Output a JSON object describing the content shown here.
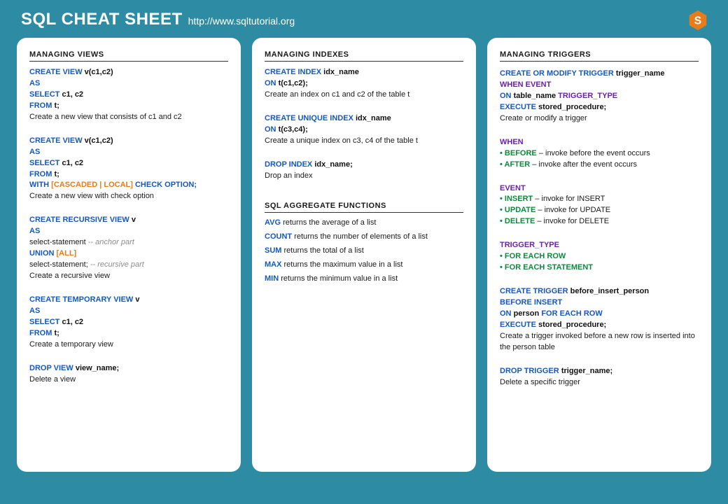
{
  "header": {
    "title": "SQL CHEAT SHEET",
    "url": "http://www.sqltutorial.org"
  },
  "col1": {
    "section1_title": "MANAGING  VIEWS",
    "items": [
      {
        "code_html": "<span class='kw'>CREATE VIEW</span> <span class='str'>v(c1,c2)</span><br><span class='kw'>AS</span><br><span class='kw'>SELECT</span> <span class='str'>c1, c2</span><br><span class='kw'>FROM</span> <span class='str'>t;</span>",
        "desc": "Create a new view that consists  of c1 and c2"
      },
      {
        "code_html": "<span class='kw'>CREATE VIEW</span> <span class='str'>v(c1,c2)</span><br><span class='kw'>AS</span><br><span class='kw'>SELECT</span> <span class='str'>c1, c2</span><br><span class='kw'>FROM</span> <span class='str'>t;</span><br><span class='kw'>WITH</span> <span class='orange'>[CASCADED | LOCAL]</span> <span class='kw'>CHECK OPTION;</span>",
        "desc": "Create a new view with check option"
      },
      {
        "code_html": "<span class='kw'>CREATE RECURSIVE  VIEW</span> <span class='str'>v</span><br><span class='kw'>AS</span><br>select-statement  <span class='comment'>-- anchor part</span><br><span class='kw'>UNION</span> <span class='orange'>[ALL]</span><br>select-statement;  <span class='comment'>-- recursive part</span>",
        "desc": "Create a recursive view"
      },
      {
        "code_html": "<span class='kw'>CREATE TEMPORARY  VIEW</span> <span class='str'>v</span><br><span class='kw'>AS</span><br><span class='kw'>SELECT</span> <span class='str'>c1, c2</span><br><span class='kw'>FROM</span> <span class='str'>t;</span>",
        "desc": "Create a temporary view"
      },
      {
        "code_html": "<span class='kw'>DROP VIEW</span> <span class='str'>view_name;</span>",
        "desc": "Delete a view"
      }
    ]
  },
  "col2": {
    "section1_title": "MANAGING  INDEXES",
    "items1": [
      {
        "code_html": "<span class='kw'>CREATE INDEX</span> <span class='str'>idx_name</span><br><span class='kw'>ON</span> <span class='str'>t(c1,c2);</span>",
        "desc": "Create an index on c1 and c2 of the table t"
      },
      {
        "code_html": "<span class='kw'>CREATE UNIQUE INDEX</span> <span class='str'>idx_name</span><br><span class='kw'>ON</span> <span class='str'>t(c3,c4);</span>",
        "desc": "Create a unique index on c3, c4 of the table t"
      },
      {
        "code_html": "<span class='kw'>DROP INDEX</span> <span class='str'>idx_name;</span>",
        "desc": "Drop an index"
      }
    ],
    "section2_title": "SQL AGGREGATE  FUNCTIONS",
    "functions": [
      {
        "name": "AVG",
        "desc": "returns the average of a list"
      },
      {
        "name": "COUNT",
        "desc": "returns the number of elements of a list"
      },
      {
        "name": "SUM",
        "desc": "returns the total of a list"
      },
      {
        "name": "MAX",
        "desc": "returns the maximum value in a list"
      },
      {
        "name": "MIN",
        "desc": "returns the minimum  value in a list"
      }
    ]
  },
  "col3": {
    "section1_title": "MANAGING  TRIGGERS",
    "block1_code_html": "<span class='kw'>CREATE OR MODIFY TRIGGER</span> <span class='str'>trigger_name</span><br><span class='purple'>WHEN EVENT</span><br><span class='kw'>ON</span> <span class='str'>table_name</span> <span class='purple'>TRIGGER_TYPE</span><br><span class='kw'>EXECUTE</span> <span class='str'>stored_procedure;</span>",
    "block1_desc": "Create or modify a trigger",
    "when_label": "WHEN",
    "when_items": [
      {
        "kw": "BEFORE",
        "text": " – invoke before the event occurs"
      },
      {
        "kw": "AFTER",
        "text": " – invoke after the event occurs"
      }
    ],
    "event_label": "EVENT",
    "event_items": [
      {
        "kw": "INSERT",
        "text": " – invoke for INSERT"
      },
      {
        "kw": "UPDATE",
        "text": " – invoke for UPDATE"
      },
      {
        "kw": "DELETE",
        "text": " – invoke for DELETE"
      }
    ],
    "type_label": "TRIGGER_TYPE",
    "type_items": [
      {
        "kw": "FOR EACH ROW",
        "text": ""
      },
      {
        "kw": "FOR EACH STATEMENT",
        "text": ""
      }
    ],
    "block2_code_html": "<span class='kw'>CREATE TRIGGER</span> <span class='str'>before_insert_person</span><br><span class='kw'>BEFORE INSERT</span><br><span class='kw'>ON</span> <span class='str'>person</span> <span class='kw'>FOR EACH ROW</span><br><span class='kw'>EXECUTE</span> <span class='str'>stored_procedure;</span>",
    "block2_desc": "Create a trigger invoked before a new row is inserted into the person table",
    "block3_code_html": "<span class='kw'>DROP TRIGGER</span> <span class='str'>trigger_name;</span>",
    "block3_desc": "Delete a specific trigger"
  }
}
